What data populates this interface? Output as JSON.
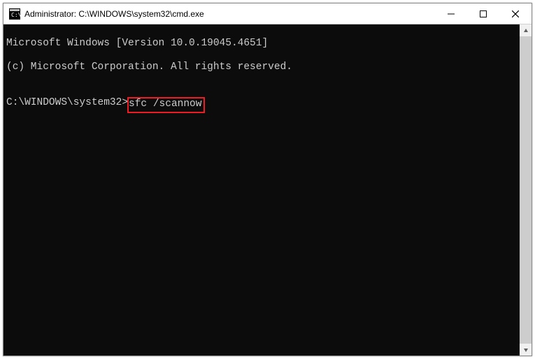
{
  "titlebar": {
    "title": "Administrator: C:\\WINDOWS\\system32\\cmd.exe"
  },
  "terminal": {
    "line1": "Microsoft Windows [Version 10.0.19045.4651]",
    "line2": "(c) Microsoft Corporation. All rights reserved.",
    "blank": "",
    "prompt": "C:\\WINDOWS\\system32>",
    "command": "sfc /scannow"
  }
}
